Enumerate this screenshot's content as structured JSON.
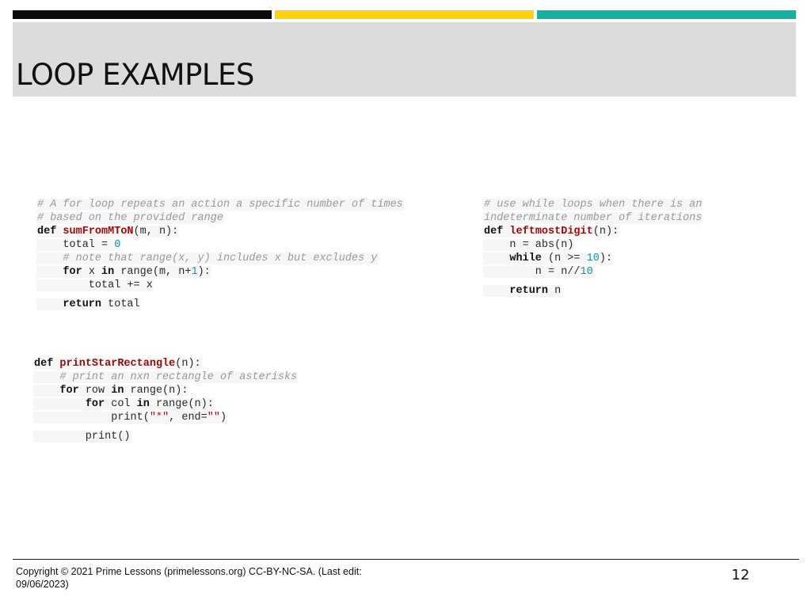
{
  "header": {
    "title": "LOOP EXAMPLES",
    "accent_colors": [
      "#0b0b0b",
      "#fdd208",
      "#15b1a0"
    ]
  },
  "code_blocks": [
    {
      "lines": [
        [
          {
            "t": "# A for loop repeats an action a specific number of times",
            "c": "cm"
          }
        ],
        [
          {
            "t": "# based on the provided range",
            "c": "cm"
          }
        ],
        [
          {
            "t": "def",
            "c": "kw"
          },
          {
            "t": " "
          },
          {
            "t": "sumFromMToN",
            "c": "fn"
          },
          {
            "t": "(m, n):"
          }
        ],
        [
          {
            "t": "    total = "
          },
          {
            "t": "0",
            "c": "num"
          }
        ],
        [
          {
            "t": "    "
          },
          {
            "t": "# note that range(x, y) includes x but excludes y",
            "c": "cm"
          }
        ],
        [
          {
            "t": "    "
          },
          {
            "t": "for",
            "c": "kw"
          },
          {
            "t": " x "
          },
          {
            "t": "in",
            "c": "kw"
          },
          {
            "t": " range(m, n+"
          },
          {
            "t": "1",
            "c": "num"
          },
          {
            "t": "):"
          }
        ],
        [
          {
            "t": "        total += x"
          }
        ],
        [
          {
            "t": "    "
          },
          {
            "t": "return",
            "c": "kw"
          },
          {
            "t": " total"
          }
        ]
      ]
    },
    {
      "lines": [
        [
          {
            "t": "# use while loops when there is an",
            "c": "cm"
          }
        ],
        [
          {
            "t": "indeterminate number of iterations",
            "c": "cm"
          }
        ],
        [
          {
            "t": "def",
            "c": "kw"
          },
          {
            "t": " "
          },
          {
            "t": "leftmostDigit",
            "c": "fn"
          },
          {
            "t": "(n):"
          }
        ],
        [
          {
            "t": "    n = abs(n)"
          }
        ],
        [
          {
            "t": "    "
          },
          {
            "t": "while",
            "c": "kw"
          },
          {
            "t": " (n >= "
          },
          {
            "t": "10",
            "c": "num"
          },
          {
            "t": "):"
          }
        ],
        [
          {
            "t": "        n = n//"
          },
          {
            "t": "10",
            "c": "num"
          }
        ],
        [
          {
            "t": "    "
          },
          {
            "t": "return",
            "c": "kw"
          },
          {
            "t": " n"
          }
        ]
      ]
    },
    {
      "lines": [
        [
          {
            "t": "def",
            "c": "kw"
          },
          {
            "t": " "
          },
          {
            "t": "printStarRectangle",
            "c": "fn"
          },
          {
            "t": "(n):"
          }
        ],
        [
          {
            "t": "    "
          },
          {
            "t": "# print an nxn rectangle of asterisks",
            "c": "cm"
          }
        ],
        [
          {
            "t": "    "
          },
          {
            "t": "for",
            "c": "kw"
          },
          {
            "t": " row "
          },
          {
            "t": "in",
            "c": "kw"
          },
          {
            "t": " range(n):"
          }
        ],
        [
          {
            "t": "        "
          },
          {
            "t": "for",
            "c": "kw"
          },
          {
            "t": " col "
          },
          {
            "t": "in",
            "c": "kw"
          },
          {
            "t": " range(n):"
          }
        ],
        [
          {
            "t": "            print("
          },
          {
            "t": "\"*\"",
            "c": "str"
          },
          {
            "t": ", end="
          },
          {
            "t": "\"\"",
            "c": "str"
          },
          {
            "t": ")"
          }
        ],
        [
          {
            "t": "        print()"
          }
        ]
      ]
    }
  ],
  "footer": {
    "copyright": "Copyright © 2021 Prime Lessons (primelessons.org) CC-BY-NC-SA.  (Last edit: 09/06/2023)",
    "page_number": "12"
  }
}
